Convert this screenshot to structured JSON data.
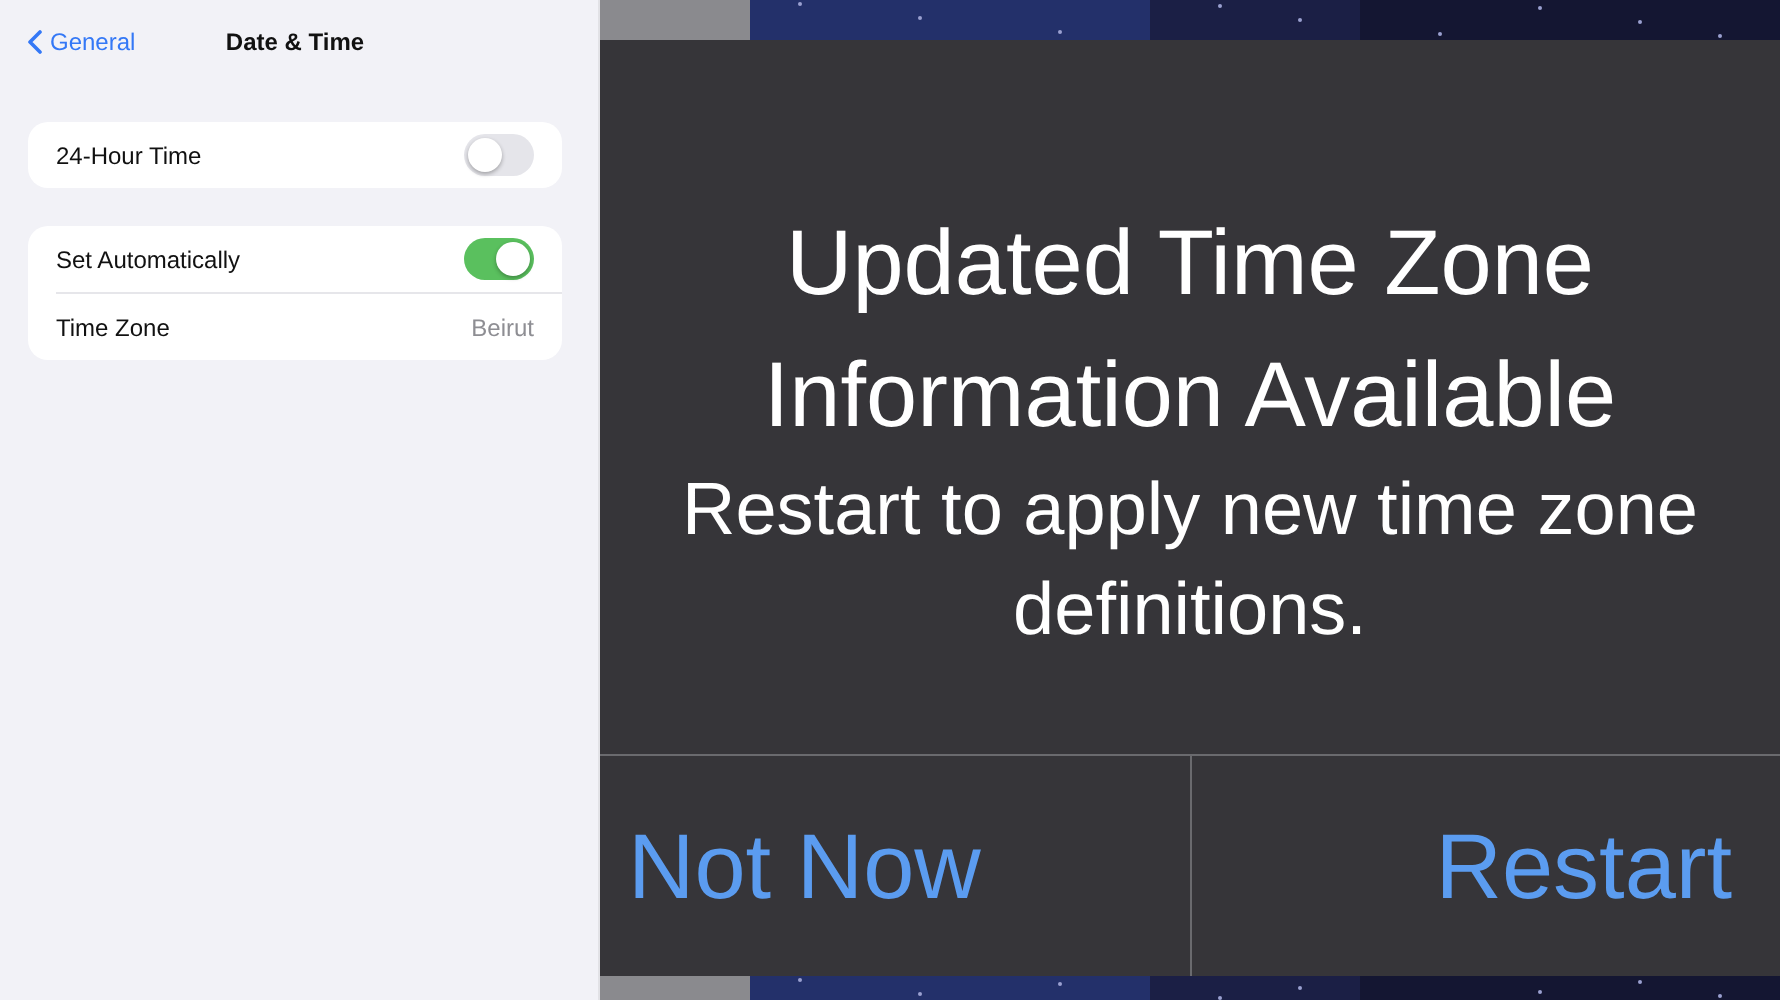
{
  "settings": {
    "back": "General",
    "title": "Date & Time",
    "groups": [
      {
        "rows": [
          {
            "kind": "toggle",
            "label": "24-Hour Time",
            "on": false
          }
        ]
      },
      {
        "rows": [
          {
            "kind": "toggle",
            "label": "Set Automatically",
            "on": true
          },
          {
            "kind": "value",
            "label": "Time Zone",
            "value": "Beirut"
          }
        ]
      }
    ]
  },
  "alert": {
    "title": "Updated Time Zone Information Available",
    "message": "Restart to apply new time zone definitions.",
    "buttons": [
      {
        "label": "Not Now",
        "kind": "cancel"
      },
      {
        "label": "Restart",
        "kind": "default"
      }
    ]
  }
}
